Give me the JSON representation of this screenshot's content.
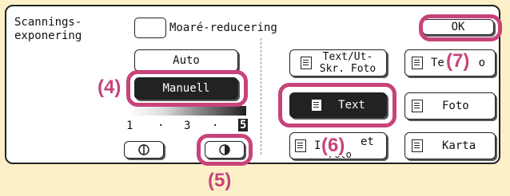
{
  "exposure_label": "Scannings-\nexponering",
  "moire": {
    "label": "Moaré-reducering"
  },
  "ok_label": "OK",
  "modes": {
    "auto": "Auto",
    "manual": "Manuell"
  },
  "scale": {
    "one": "1",
    "dot1": "·",
    "three": "3",
    "dot2": "·",
    "five": "5"
  },
  "originals": {
    "text_print_photo": "Text/Ut-\nSkr. Foto",
    "text_photo_partial": "Te",
    "text_photo_partial_tail": "o",
    "text": "Text",
    "photo": "Foto",
    "printed_partial_left": "I",
    "printed_partial_right": "et",
    "printed_partial_bottom": "Foto",
    "map": "Karta"
  },
  "callouts": {
    "c4": "(4)",
    "c5": "(5)",
    "c6": "(6)",
    "c7": "(7)"
  },
  "colors": {
    "callout": "#c8437a",
    "background": "#fbf0c8"
  }
}
